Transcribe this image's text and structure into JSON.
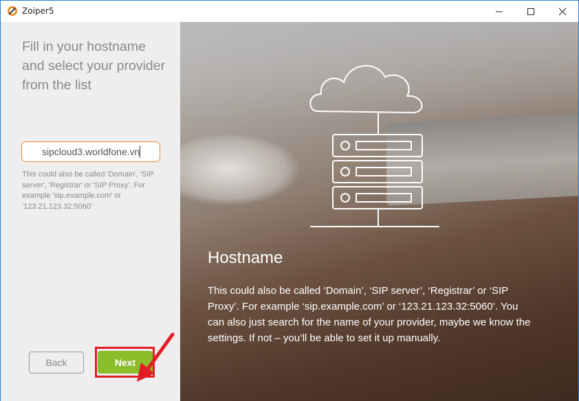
{
  "window": {
    "title": "Zoiper5",
    "minimize_glyph": "—",
    "maximize_glyph": "☐",
    "close_glyph": "✕"
  },
  "left": {
    "heading": "Fill in your hostname and select your provider from the list",
    "hostname_value": "sipcloud3.worldfone.vn",
    "hint": "This could also be called 'Domain', 'SIP server', 'Registrar' or 'SIP Proxy'. For example 'sip.example.com' or '123.21.123.32:5060'",
    "back_label": "Back",
    "next_label": "Next"
  },
  "right": {
    "title": "Hostname",
    "body": "This could also be called ‘Domain’, ‘SIP server’, ‘Registrar’ or ‘SIP Proxy’. For example ‘sip.example.com’ or ‘123.21.123.32:5060’. You can also just search for the name of your provider, maybe we know the settings. If not – you’ll be able to set it up manually."
  },
  "colors": {
    "accent_orange": "#e78a3c",
    "next_green": "#8bbd2a",
    "highlight_red": "#e01e24",
    "left_bg": "#eeeeee"
  },
  "icons": {
    "app": "zoiper-icon",
    "illustration": "cloud-server-icon",
    "annotation": "red-arrow-icon"
  }
}
